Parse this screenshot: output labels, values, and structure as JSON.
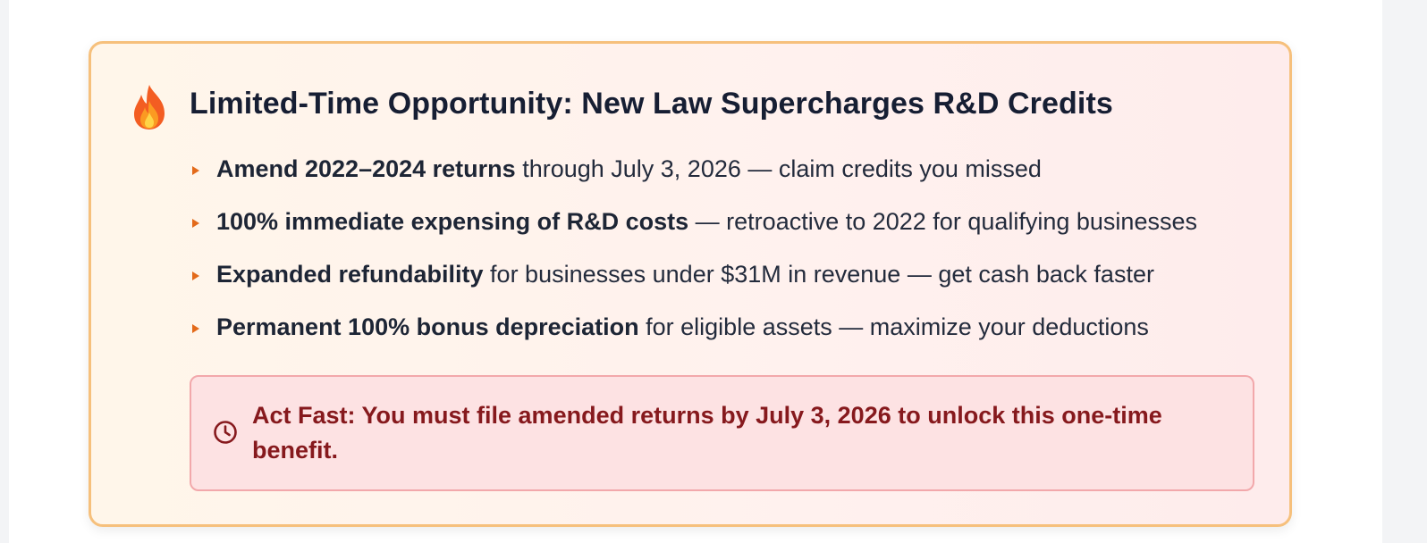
{
  "promo": {
    "icon": "fire-icon",
    "title": "Limited-Time Opportunity: New Law Supercharges R&D Credits",
    "items": [
      {
        "bold": "Amend 2022–2024 returns",
        "text": " through July 3, 2026 — claim credits you missed"
      },
      {
        "bold": "100% immediate expensing of R&D costs",
        "text": " — retroactive to 2022 for qualifying businesses"
      },
      {
        "bold": "Expanded refundability",
        "text": " for businesses under $31M in revenue — get cash back faster"
      },
      {
        "bold": "Permanent 100% bonus depreciation",
        "text": " for eligible assets — maximize your deductions"
      }
    ],
    "alert": {
      "icon": "clock-icon",
      "text": "Act Fast: You must file amended returns by July 3, 2026 to unlock this one-time benefit."
    }
  },
  "colors": {
    "card_border": "#f6c07c",
    "bullet": "#e36a1a",
    "alert_background": "#fde2e3",
    "alert_border": "#f2a8ab",
    "alert_text": "#86191d",
    "title_text": "#161e33"
  }
}
